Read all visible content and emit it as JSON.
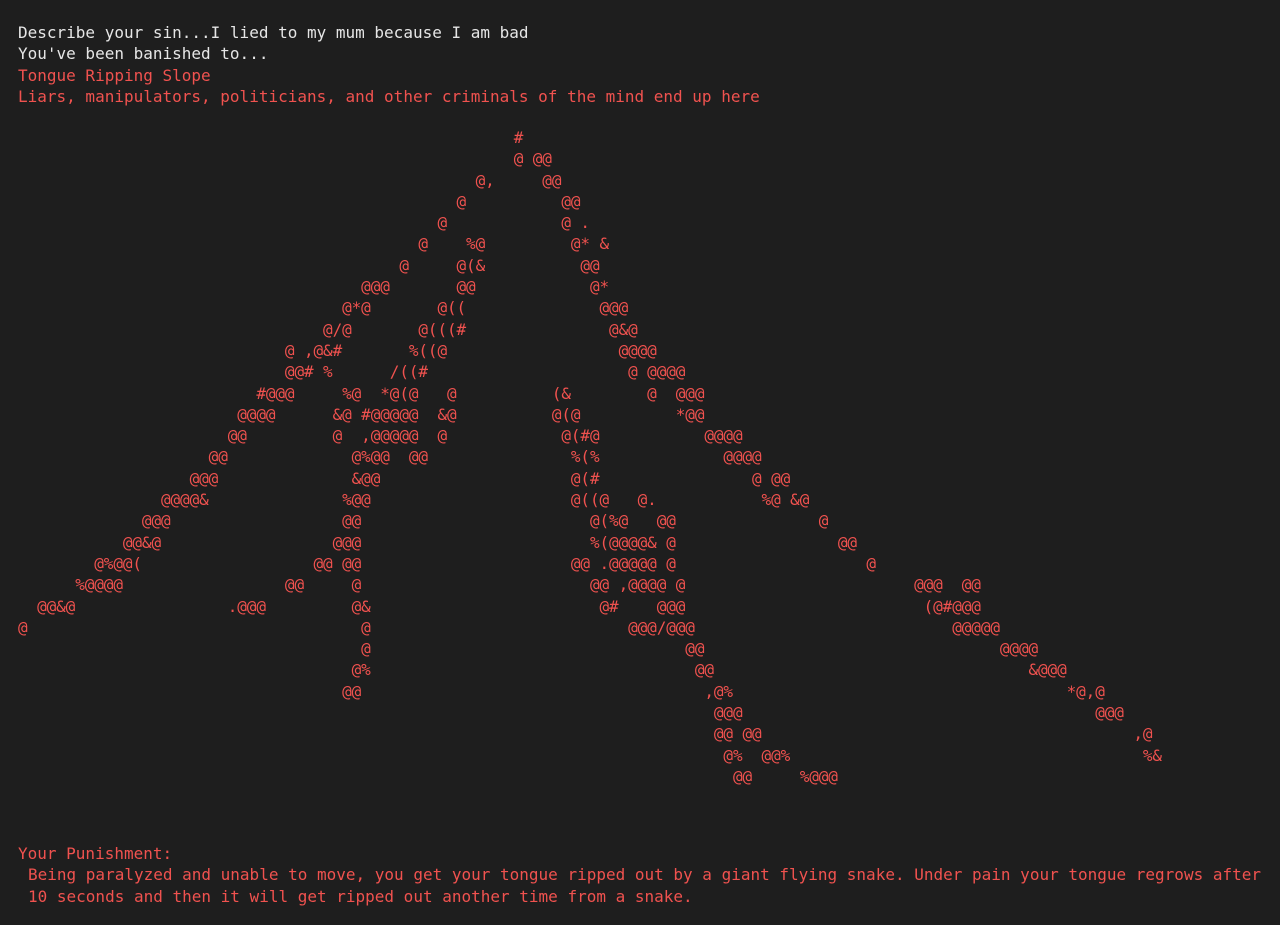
{
  "header": {
    "prompt_line": "Describe your sin...I lied to my mum because I am bad",
    "banished_line": "You've been banished to...",
    "location_name": "Tongue Ripping Slope",
    "location_description": "Liars, manipulators, politicians, and other criminals of the mind end up here"
  },
  "art": {
    "lines": [
      "                                                    #",
      "                                                    @ @@",
      "                                                @,     @@",
      "                                              @          @@",
      "                                            @            @ .",
      "                                          @    %@         @* &",
      "                                        @     @(&          @@",
      "                                    @@@       @@            @*",
      "                                  @*@       @((              @@@",
      "                                @/@       @(((#               @&@",
      "                            @ ,@&#       %((@                  @@@@",
      "                            @@# %      /((#                     @ @@@@",
      "                         #@@@     %@  *@(@   @          (&        @  @@@",
      "                       @@@@      &@ #@@@@@  &@          @(@          *@@",
      "                      @@         @  ,@@@@@  @            @(#@           @@@@",
      "                    @@             @%@@  @@               %(%             @@@@",
      "                  @@@              &@@                    @(#                @ @@",
      "               @@@@&              %@@                     @((@   @.           %@ &@",
      "             @@@                  @@                        @(%@   @@               @",
      "           @@&@                  @@@                        %(@@@@& @                 @@",
      "        @%@@(                  @@ @@                      @@ .@@@@@ @                    @",
      "      %@@@@                 @@     @                        @@ ,@@@@ @                        @@@  @@",
      "  @@&@                .@@@         @&                        @#    @@@                         (@#@@@",
      "@                                   @                           @@@/@@@                           @@@@@",
      "                                    @                                 @@                               @@@@",
      "                                   @%                                  @@                                 &@@@",
      "                                  @@                                    ,@%                                   *@,@",
      "                                                                         @@@                                     @@@",
      "                                                                         @@ @@                                       ,@",
      "                                                                          @%  @@%                                     %&",
      "                                                                           @@     %@@@"
    ]
  },
  "footer": {
    "punishment_label": "Your Punishment:",
    "punishment_text": "Being paralyzed and unable to move, you get your tongue ripped out by a giant flying snake. Under pain your tongue regrows after 10 seconds and then it will get ripped out another time from a snake."
  },
  "colors": {
    "background": "#1e1e1e",
    "text_default": "#e6e6e6",
    "text_accent": "#f0524f"
  }
}
